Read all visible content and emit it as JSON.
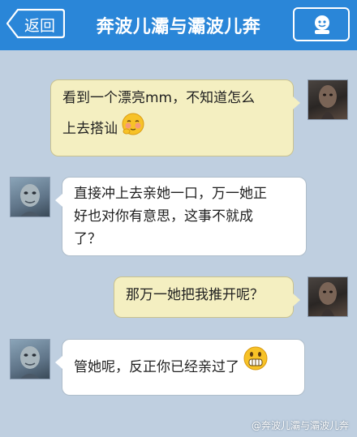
{
  "header": {
    "back_label": "返回",
    "title": "奔波儿灞与灞波儿奔"
  },
  "messages": [
    {
      "side": "right",
      "line1": "看到一个漂亮mm，不知道怎么",
      "line2": "上去搭讪",
      "emoji": "shy-emoji"
    },
    {
      "side": "left",
      "line1": "直接冲上去亲她一口，万一她正",
      "line2": "好也对你有意思，这事不就成",
      "line3": "了？"
    },
    {
      "side": "right",
      "line1": "那万一她把我推开呢？"
    },
    {
      "side": "left",
      "line1": "管她呢，反正你已经亲过了",
      "emoji": "grin-emoji"
    }
  ],
  "watermark": "@奔波儿灞与灞波儿奔",
  "colors": {
    "header": "#2a86d8",
    "background": "#bfcfe0",
    "right_bubble": "#f4efc1",
    "left_bubble": "#ffffff"
  }
}
